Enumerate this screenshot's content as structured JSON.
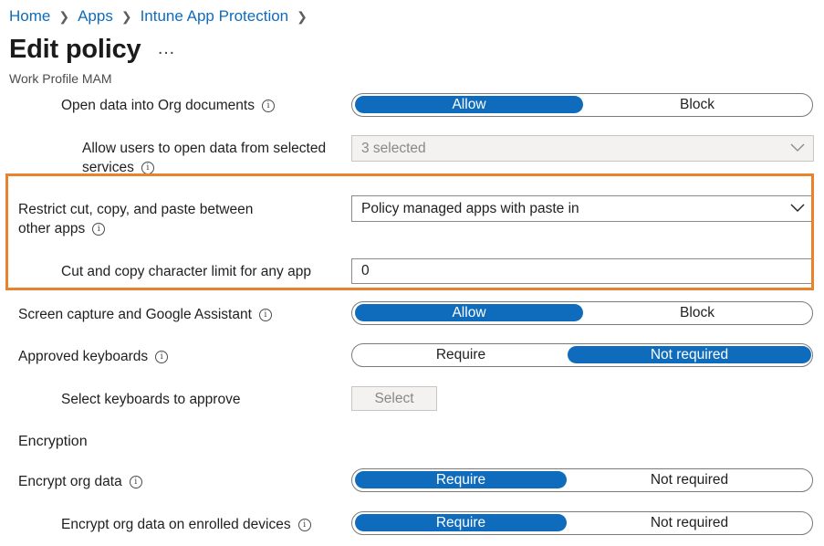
{
  "breadcrumb": [
    "Home",
    "Apps",
    "Intune App Protection"
  ],
  "header": {
    "title": "Edit policy",
    "more": "…",
    "subtitle": "Work Profile MAM"
  },
  "rows": {
    "open_data": {
      "label": "Open data into Org documents",
      "options": [
        "Allow",
        "Block"
      ],
      "selected": "Allow"
    },
    "allow_users": {
      "label_line1": "Allow users to open data from selected",
      "label_line2": "services",
      "value": "3 selected"
    },
    "restrict_cut": {
      "label_line1": "Restrict cut, copy, and paste between",
      "label_line2": "other apps",
      "value": "Policy managed apps with paste in"
    },
    "cut_limit": {
      "label": "Cut and copy character limit for any app",
      "value": "0"
    },
    "screen_capture": {
      "label": "Screen capture and Google Assistant",
      "options": [
        "Allow",
        "Block"
      ],
      "selected": "Allow"
    },
    "approved_keyboards": {
      "label": "Approved keyboards",
      "options": [
        "Require",
        "Not required"
      ],
      "selected": "Not required"
    },
    "select_keyboards": {
      "label": "Select keyboards to approve",
      "button": "Select"
    },
    "encryption_heading": "Encryption",
    "encrypt_org": {
      "label": "Encrypt org data",
      "options": [
        "Require",
        "Not required"
      ],
      "selected": "Require"
    },
    "encrypt_enrolled": {
      "label": "Encrypt org data on enrolled devices",
      "options": [
        "Require",
        "Not required"
      ],
      "selected": "Require"
    }
  },
  "colors": {
    "accent": "#0f6cbd",
    "highlight": "#e8822c"
  }
}
